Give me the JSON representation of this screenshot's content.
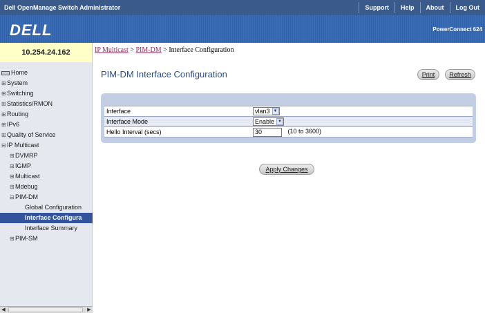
{
  "app": {
    "title": "Dell OpenManage Switch Administrator",
    "links": [
      "Support",
      "Help",
      "About",
      "Log Out"
    ],
    "logo": "DELL",
    "model": "PowerConnect 624"
  },
  "sidebar": {
    "ip": "10.254.24.162",
    "items": [
      {
        "label": "Home",
        "icon": "home-icon"
      },
      {
        "label": "System",
        "icon": "expand-icon"
      },
      {
        "label": "Switching",
        "icon": "expand-icon"
      },
      {
        "label": "Statistics/RMON",
        "icon": "expand-icon"
      },
      {
        "label": "Routing",
        "icon": "expand-icon"
      },
      {
        "label": "IPv6",
        "icon": "expand-icon"
      },
      {
        "label": "Quality of Service",
        "icon": "expand-icon"
      },
      {
        "label": "IP Multicast",
        "icon": "collapse-icon"
      },
      {
        "label": "DVMRP",
        "icon": "expand-icon"
      },
      {
        "label": "IGMP",
        "icon": "expand-icon"
      },
      {
        "label": "Multicast",
        "icon": "expand-icon"
      },
      {
        "label": "Mdebug",
        "icon": "expand-icon"
      },
      {
        "label": "PIM-DM",
        "icon": "collapse-icon"
      },
      {
        "label": "Global Configuration"
      },
      {
        "label": "Interface Configura"
      },
      {
        "label": "Interface Summary"
      },
      {
        "label": "PIM-SM",
        "icon": "expand-icon"
      }
    ]
  },
  "breadcrumb": {
    "link1": "IP Multicast",
    "sep": " > ",
    "link2": "PIM-DM",
    "current": "Interface Configuration"
  },
  "page": {
    "title": "PIM-DM Interface Configuration",
    "print_label": "Print",
    "refresh_label": "Refresh",
    "apply_label": "Apply Changes"
  },
  "form": {
    "interface_label": "Interface",
    "interface_value": "vlan3",
    "mode_label": "Interface Mode",
    "mode_value": "Enable",
    "hello_label": "Hello Interval (secs)",
    "hello_value": "30",
    "hello_range": "(10 to 3600)"
  },
  "colors": {
    "topbar": "#3a5a8c",
    "brand": "#2e5fa8",
    "sidebar": "#e5e8ef",
    "selected": "#33539c",
    "panel": "#c3cde4",
    "title": "#2a4d8f"
  }
}
